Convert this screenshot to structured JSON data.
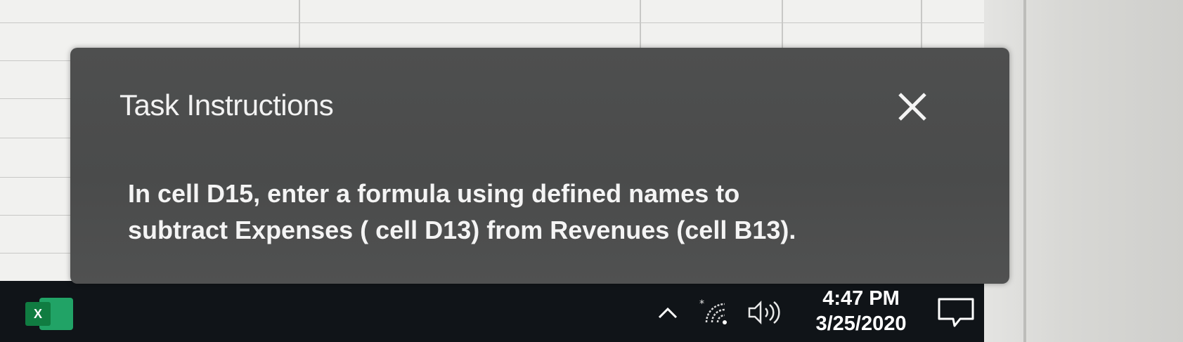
{
  "dialog": {
    "title": "Task Instructions",
    "close_icon": "close-icon",
    "body_line_1": "In cell D15, enter a formula using defined names to",
    "body_line_2": "subtract Expenses ( cell D13) from Revenues (cell B13)."
  },
  "taskbar": {
    "app_icon": "excel-icon",
    "app_icon_letter": "X",
    "tray_icons": [
      "chevron-up-icon",
      "wifi-icon",
      "volume-icon",
      "notification-icon"
    ],
    "chevron_glyph": "^",
    "clock_time": "4:47 PM",
    "clock_date": "3/25/2020"
  },
  "colors": {
    "dialog_background": "#4b4c4c",
    "taskbar_background": "#101418",
    "excel_green": "#107c41",
    "sheet_background": "#f1f1ef"
  }
}
